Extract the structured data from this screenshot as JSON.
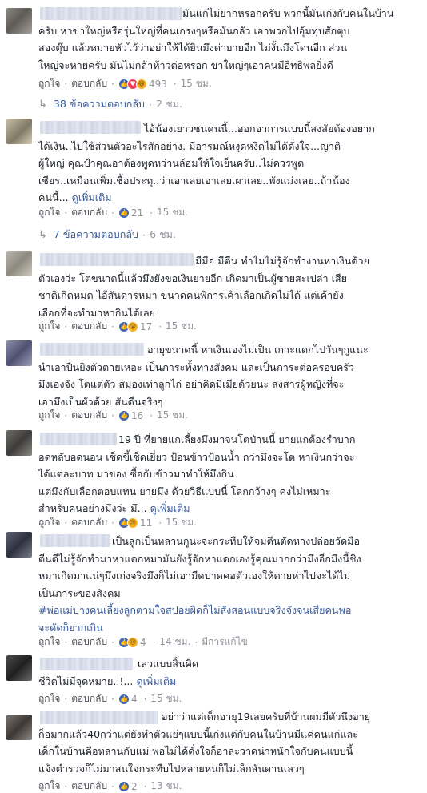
{
  "labels": {
    "like": "ถูกใจ",
    "reply": "ตอบกลับ",
    "more": "ดูเพิ่มเติม",
    "edited": "มีการแก้ไข",
    "dot": "·"
  },
  "comments": [
    {
      "text": "มันแก่ไม่ยากหรอกครับ พวกนี้มันเก่งกับคนในบ้าน\nครับ หาขาใหญ่หรือรุ่นใหญ่ที่คนเกรงๆหรือมันกลัว เอาพวกไปอุ้มทุบสักตุบ\nสองตุ๊บ แล้วหมายหัวไว้ว่าอย่าให้ได้ยินมึงด่ายายอีก ไม่งั้นมึงโดนอีก ส่วน\nใหญ่จะหายครับ มันไม่กล้าห้าวต่อหรอก ขาใหญ่ๆเอาคนมีอิทธิพลยิ่งดี",
      "reactions": [
        "like",
        "love",
        "haha"
      ],
      "count": "493",
      "time": "15 ชม.",
      "replies": {
        "label": "38 ข้อความตอบกลับ",
        "time": "2 ชม."
      }
    },
    {
      "text": "ไอ้น้องเยาวชนคนนี้...ออกอาการแบบนี้สงสัยต้องอยาก\nได้เงิน..ไปใช้ส่วนตัวอะไรสักอย่าง. มีอารมณ์หงุดหงิดไม่ได้ดั่งใจ...ญาติ\nผู้ใหญ่ คุณป้าคุณอาต้องพูดหว่านล้อมให้ใจเย็นครับ..ไม่ควรพูด\nเชียร..เหมือนเพิ่มเชื้อประทุ..ว่าเอาเลยเอาเลยเผาเลย..พังแม่งเลย..ถ้าน้อง\nคนนี้...",
      "more": true,
      "reactions": [
        "like"
      ],
      "count": "21",
      "time": "15 ชม.",
      "replies": {
        "label": "7 ข้อความตอบกลับ",
        "time": "6 ชม."
      }
    },
    {
      "text": "มีมือ มีตีน ทำไมไม่รู้จักทำงานหาเงินด้วย\nตัวเองว่ะ โตขนาดนี้แล้วมึงยังขอเงินยายอีก เกิดมาเป็นผู้ชายสะเปล่า เสีย\nชาติเกิดหมด ไอ้สันดารหมา ขนาดคนพิการเค้าเลือกเกิดไม่ได้ แต่เค้ายัง\nเลือกที่จะทำมาหากินได้เลย",
      "reactions": [
        "like",
        "wow"
      ],
      "count": "17",
      "time": "15 ชม."
    },
    {
      "text": "อายุขนาดนี้ หาเงินเองไม่เป็น เกาะแดกไปวันๆกูแนะ\nนำเอาปืนยิงตัวตายเหอะ เป็นภาระทั้งทางสังคม และเป็นภาระต่อครอบครัว\nมึงเองจัง โตแต่ตัว สมองเท่าลูกไก่ อย่าคิดมีเมียด้วยนะ สงสารผู้หญิงที่จะ\nเอามึงเป็นผัวด้วย สันดีนจริงๆ",
      "reactions": [
        "like"
      ],
      "count": "16",
      "time": "15 ชม."
    },
    {
      "text": "19 ปี ที่ยายแกเลี้ยงมึงมาจนโตป่านนี้ ยายแกต้องรำบาก\nอดหลับอดนอน เช็ดขี้เช็ดเยี่ยว ป้อนข้าวป้อนน้ำ กว่ามึงจะโต หาเงินกว่าจะ\nได้แต่ละบาท มาของ ซื้อกับข้าวมาทำให้มึงกิน\nแต่มึงกับเลือกตอบแทน ยายมึง ด้วยวิธีแบบนี้ โลกกว้างๆ คงไม่เหมาะ\nสำหรับคนอย่างมึงว่ะ มึ...",
      "more": true,
      "reactions": [
        "like",
        "sad"
      ],
      "count": "11",
      "time": "15 ชม."
    },
    {
      "text": "เป็นลูกเป็นหลานกูนะจะกระทืบให้จมตีนตัดหางปล่อยวัดมือ\nตีนตีไม่รู้จักทำมาหาแดกหมามันยังรู้จักหาแดกเองรู้คุณมากกว่ามึงอีกมึงนี้ชิง\nหมาเกิดมาแน่ๆมึงเก่งจริงมึงก็ไม่เอามีดปาดคอตัวเองให้ตายห่าไปจะได้ไม่\nเป็นภาระของสังคม",
      "hashtag": "#พ่อแม่บางคนเลี้ยงลูกตามใจสปอยผิดก็ไม่สั่งสอนแบบจริงจังจนเสียคนพอ\nจะดัดก็ยากเกิน",
      "reactions": [
        "like",
        "sad"
      ],
      "count": "4",
      "time": "14 ชม.",
      "edited": true
    },
    {
      "text": "เลวแบบสิ้นคิด\nชีวิตไม่มีจุดหมาย..!...",
      "more": true,
      "reactions": [
        "like"
      ],
      "count": "4",
      "time": "15 ชม."
    },
    {
      "text": "อย่าว่าแต่เด็กอายุ19เลยครับที่บ้านผมมีตัวนึงอายุ\nก็อมากแล้ว40กว่าแต่ยังทำตัวแย่ๆแบบนี้เก่งแต่กับคนในบ้านมีแค่คนแก่และ\nเด็กในบ้านคือหลานกับแม่ พอไม่ได้ดั่งใจก็อาละวาดน่าหนักใจกับคนแบบนี้\nแจ้งตำรวจก็ไม่มาสนใจกระทืบไปหลายหนก็ไม่เล็กสันดานเลวๆ",
      "reactions": [
        "like"
      ],
      "count": "2",
      "time": "13 ชม."
    }
  ]
}
